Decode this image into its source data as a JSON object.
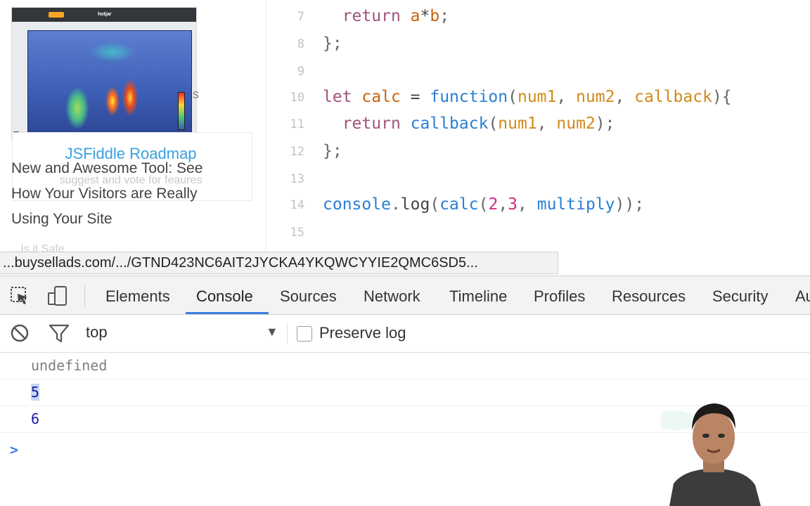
{
  "sidebar": {
    "ad_logo": "hotjar",
    "ad_side_text": "s",
    "card_title": "JSFiddle Roadmap",
    "card_subtitle": "suggest and vote for feaures",
    "article_lines": [
      "New and Awesome Tool: See",
      "How Your Visitors are Really",
      "Using Your Site"
    ],
    "faded_text": "...Is it Safe"
  },
  "editor": {
    "lines": [
      {
        "n": "7",
        "tokens": [
          [
            "  ",
            ""
          ],
          [
            "return",
            "kw"
          ],
          [
            " ",
            ""
          ],
          [
            "a",
            "vn"
          ],
          [
            "*",
            "op"
          ],
          [
            "b",
            "vn"
          ],
          [
            ";",
            "pn"
          ]
        ]
      },
      {
        "n": "8",
        "tokens": [
          [
            "};",
            "pn"
          ]
        ]
      },
      {
        "n": "9",
        "tokens": []
      },
      {
        "n": "10",
        "tokens": [
          [
            "let",
            "kw"
          ],
          [
            " ",
            ""
          ],
          [
            "calc",
            "vn"
          ],
          [
            " = ",
            "op"
          ],
          [
            "function",
            "fn"
          ],
          [
            "(",
            "pn"
          ],
          [
            "num1",
            "pr"
          ],
          [
            ", ",
            "pn"
          ],
          [
            "num2",
            "pr"
          ],
          [
            ", ",
            "pn"
          ],
          [
            "callback",
            "pr"
          ],
          [
            "){",
            "pn"
          ]
        ]
      },
      {
        "n": "11",
        "tokens": [
          [
            "  ",
            ""
          ],
          [
            "return",
            "kw"
          ],
          [
            " ",
            ""
          ],
          [
            "callback",
            "fn"
          ],
          [
            "(",
            "pn"
          ],
          [
            "num1",
            "pr"
          ],
          [
            ", ",
            "pn"
          ],
          [
            "num2",
            "pr"
          ],
          [
            ");",
            "pn"
          ]
        ]
      },
      {
        "n": "12",
        "tokens": [
          [
            "};",
            "pn"
          ]
        ]
      },
      {
        "n": "13",
        "tokens": []
      },
      {
        "n": "14",
        "tokens": [
          [
            "console",
            "fn"
          ],
          [
            ".",
            "pn"
          ],
          [
            "log",
            "op"
          ],
          [
            "(",
            "pn"
          ],
          [
            "calc",
            "fn"
          ],
          [
            "(",
            "pn"
          ],
          [
            "2",
            "nm"
          ],
          [
            ",",
            "pn"
          ],
          [
            "3",
            "nm"
          ],
          [
            ", ",
            "pn"
          ],
          [
            "multiply",
            "fn"
          ],
          [
            "));",
            "pn"
          ]
        ]
      },
      {
        "n": "15",
        "tokens": []
      }
    ]
  },
  "status_url": "...buysellads.com/.../GTND423NC6AIT2JYCKA4YKQWCYYIE2QMC6SD5...",
  "devtools": {
    "tabs": [
      "Elements",
      "Console",
      "Sources",
      "Network",
      "Timeline",
      "Profiles",
      "Resources",
      "Security",
      "Au"
    ],
    "active_tab": "Console",
    "context": "top",
    "preserve_log_label": "Preserve log",
    "preserve_log_checked": false,
    "console_messages": [
      {
        "text": "undefined",
        "kind": "undef"
      },
      {
        "text": "5",
        "kind": "num"
      },
      {
        "text": "6",
        "kind": "num"
      }
    ],
    "prompt_symbol": ">"
  },
  "colors": {
    "accent": "#3b7fe0",
    "keyword": "#a0527a",
    "function": "#2a7fd4",
    "variable": "#c8610b",
    "link": "#39a0e0"
  }
}
